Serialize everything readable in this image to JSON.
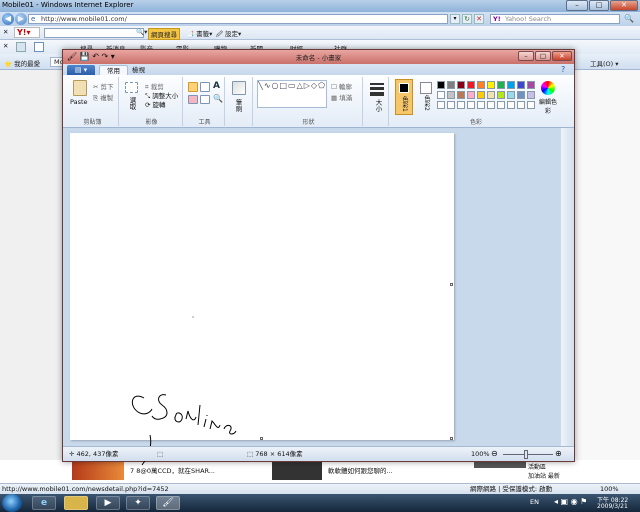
{
  "ie": {
    "title": "Mobile01 - Windows Internet Explorer",
    "address": "http://www.mobile01.com/",
    "search_placeholder": "Yahoo! Search",
    "toolbar1": {
      "search_btn": "網頁搜尋",
      "bookmarks": "書籤",
      "settings": "設定"
    },
    "toolbar2": {
      "items": [
        "搜尋",
        "新消息",
        "影音",
        "電影",
        "購物",
        "新聞",
        "財經",
        "社群"
      ]
    },
    "tab": {
      "favorites": "我的最愛",
      "tab_label": "Mobile01",
      "tools": "工具(O)"
    },
    "status_url": "http://www.mobile01.com/newsdetail.php?id=7452",
    "status_zone": "網際網路 | 受保護模式: 啟動",
    "zoom": "100%",
    "page_snippets": [
      "7 8@0萬CCD，就在SHAR...",
      "軟軟體如何跟您聊的...",
      "活動區\n加油站 最新"
    ]
  },
  "taskbar": {
    "lang": "EN",
    "time": "下午 08:22",
    "date": "2009/3/21"
  },
  "paint": {
    "title": "未命名 - 小畫家",
    "menu_btn": "▤ ▾",
    "tabs": [
      "常用",
      "檢視"
    ],
    "groups": {
      "clipboard": {
        "paste": "Paste",
        "cut": "剪下",
        "copy": "複製",
        "label": "剪貼簿"
      },
      "image": {
        "select": "選取",
        "crop": "裁剪",
        "resize": "調整大小",
        "rotate": "旋轉",
        "label": "影像"
      },
      "tools": {
        "label": "工具"
      },
      "brushes": {
        "label": "筆刷"
      },
      "shapes": {
        "outline": "輪廓",
        "fill": "填滿",
        "label": "形狀"
      },
      "size": {
        "label": "大小"
      },
      "colors": {
        "color1": "色彩1",
        "color2": "色彩2",
        "edit": "編輯色彩",
        "label": "色彩"
      }
    },
    "palette": [
      "#000000",
      "#7f7f7f",
      "#880015",
      "#ed1c24",
      "#ff7f27",
      "#fff200",
      "#22b14c",
      "#00a2e8",
      "#3f48cc",
      "#a349a4",
      "#ffffff",
      "#c3c3c3",
      "#b97a57",
      "#ffaec9",
      "#ffc90e",
      "#efe4b0",
      "#b5e61d",
      "#99d9ea",
      "#7092be",
      "#c8bfe7"
    ],
    "status": {
      "position": "462, 437像素",
      "size": "768 × 614像素",
      "zoom": "100%"
    },
    "drawing_text": "CS online"
  }
}
